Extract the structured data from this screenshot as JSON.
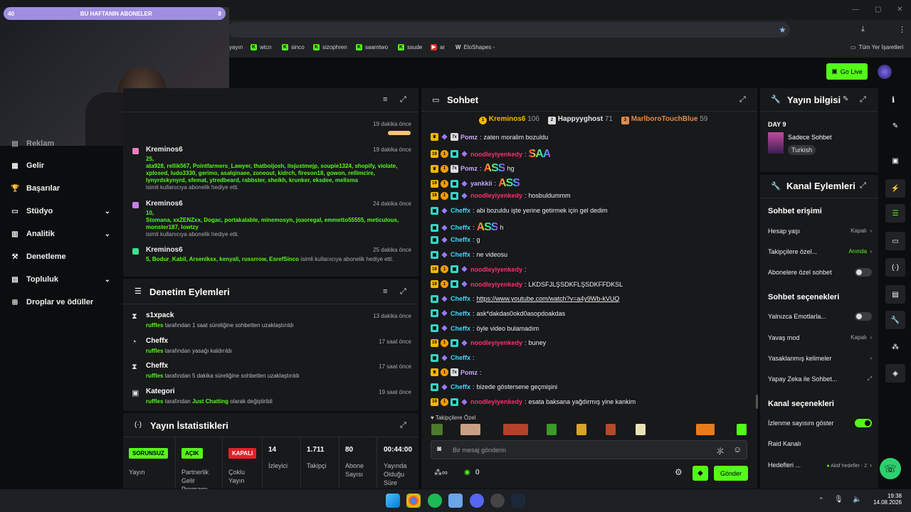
{
  "browser": {
    "bookmarks": [
      "yayın",
      "wtcn",
      "sinco",
      "sizophren",
      "saamtwo",
      "ssude",
      "ar",
      "EloShapes -"
    ],
    "all_bookmarks": "Tüm Yer İşaretleri"
  },
  "topbar": {
    "go_live": "Go Live"
  },
  "webcam": {
    "sub_left": "40",
    "sub_title": "BU HAFTANIN ABONELER",
    "sub_right": "8"
  },
  "sidenav": {
    "items": [
      {
        "label": "Reklam",
        "icon": "ad-icon"
      },
      {
        "label": "Gelir",
        "icon": "revenue-icon"
      },
      {
        "label": "Başarılar",
        "icon": "trophy-icon"
      },
      {
        "label": "Stüdyo",
        "icon": "studio-icon"
      },
      {
        "label": "Analitik",
        "icon": "analytics-icon"
      },
      {
        "label": "Denetleme",
        "icon": "moderation-icon"
      },
      {
        "label": "Topluluk",
        "icon": "community-icon"
      },
      {
        "label": "Droplar ve ödüller",
        "icon": "drops-icon"
      }
    ]
  },
  "activity": {
    "items": [
      {
        "time": "19 dakika önce"
      },
      {
        "name": "Kreminos6",
        "time": "19 dakika önce",
        "count": "25,",
        "users": "ata928, rellik567, Pointfarmers_Lawyer, thatboijosh, itsjustmejp, soupie1324, shopify, violate, xplosed, ludo3330, gerimo, asalqinaee, zoneout, kidrch, fireson18, gowon, rellimcire, lynyrdskynyrd, sfemat, ytredbeard, rabbster, sheikh, krunker, eksdee, melisma",
        "suffix": "isimli kullanıcıya abonelik hediye etti."
      },
      {
        "name": "Kreminos6",
        "time": "24 dakika önce",
        "count": "10,",
        "users": "Stomana, xxZENZxx, Dogac, portakalable, minemosyn, joaoregal, emmetto55555, meticulous, monster187, lowtzy",
        "suffix": "isimli kullanıcıya abonelik hediye etti."
      },
      {
        "name": "Kreminos6",
        "time": "25 dakika önce",
        "count": "5,",
        "users": "Bodur_Kabil, Arseniksx, kenyali, russrrow, EsrefSinco",
        "suffix": "isimli kullanıcıya abonelik hediye etti."
      }
    ]
  },
  "moderation": {
    "title": "Denetim Eylemleri",
    "items": [
      {
        "name": "s1xpack",
        "by": "ruffles",
        "desc": "tarafından 1 saat süreliğine sohbetten uzaklaştırıldı",
        "time": "13 dakika önce",
        "icon": "hourglass-icon"
      },
      {
        "name": "Cheffx",
        "by": "ruffles",
        "desc": "tarafından yasağı kaldırıldı",
        "time": "17 saat önce",
        "icon": "clock-icon"
      },
      {
        "name": "Cheffx",
        "by": "ruffles",
        "desc": "tarafından 5 dakika süreliğine sohbetten uzaklaştırıldı",
        "time": "17 saat önce",
        "icon": "hourglass-icon"
      },
      {
        "name": "Kategori",
        "by": "ruffles",
        "desc_a": "tarafından",
        "cat": "Just Chatting",
        "desc": "olarak değiştirildi",
        "time": "19 saat önce",
        "icon": "category-icon"
      }
    ]
  },
  "stats": {
    "title": "Yayın İstatistikleri",
    "cols": [
      {
        "badge": "SORUNSUZ",
        "label": "Yayın",
        "color": "#53fc18"
      },
      {
        "badge": "AÇIK",
        "label": "Partnerlik Gelir Programı",
        "color": "#53fc18"
      },
      {
        "badge": "KAPALI",
        "label": "Çoklu Yayın",
        "color": "#e5202b"
      },
      {
        "value": "14",
        "label": "İzleyici"
      },
      {
        "value": "1.711",
        "label": "Takipçi"
      },
      {
        "value": "80",
        "label": "Abone Sayısı"
      },
      {
        "value": "00:44:00",
        "label": "Yayında Olduğu Süre"
      }
    ]
  },
  "chat": {
    "title": "Sohbet",
    "top": [
      {
        "name": "Kreminos6",
        "val": "106"
      },
      {
        "name": "Happyyghost",
        "val": "71"
      },
      {
        "name": "MarlboroTouchBlue",
        "val": "59"
      }
    ],
    "messages": [
      {
        "badges": [
          "crown",
          "gem",
          "vip"
        ],
        "user": "Pomz",
        "color": "#c9a8ff",
        "text": "zaten moralim bozuldu"
      },
      {
        "badges": [
          "sub19",
          "coin",
          "tile",
          "gem"
        ],
        "user": "noodleyiyenkedy",
        "color": "#ff2d6f",
        "emote": "SAA"
      },
      {
        "badges": [
          "crown",
          "coin",
          "vip"
        ],
        "user": "Pomz",
        "color": "#c9a8ff",
        "emote": "ASS",
        "text": "hg"
      },
      {
        "badges": [
          "sub19",
          "coin",
          "tile",
          "gem"
        ],
        "user": "yankkii",
        "color": "#c9a8ff",
        "emote": "ASS"
      },
      {
        "badges": [
          "sub19",
          "coin",
          "tile",
          "gem"
        ],
        "user": "noodleyiyenkedy",
        "color": "#ff2d6f",
        "text": "hosbuldummm"
      },
      {
        "badges": [
          "tile",
          "gem"
        ],
        "user": "Cheffx",
        "color": "#3fd8ff",
        "text": "abi bozuldu işte yerine getirmek için gel dedim"
      },
      {
        "badges": [
          "tile",
          "gem"
        ],
        "user": "Cheffx",
        "color": "#3fd8ff",
        "emote": "ASS",
        "text": "h"
      },
      {
        "badges": [
          "tile",
          "gem"
        ],
        "user": "Cheffx",
        "color": "#3fd8ff",
        "text": "g"
      },
      {
        "badges": [
          "tile",
          "gem"
        ],
        "user": "Cheffx",
        "color": "#3fd8ff",
        "text": "ne videosu"
      },
      {
        "badges": [
          "sub19",
          "coin",
          "tile",
          "gem"
        ],
        "user": "noodleyiyenkedy",
        "color": "#ff2d6f",
        "text": ""
      },
      {
        "badges": [
          "sub19",
          "coin",
          "tile",
          "gem"
        ],
        "user": "noodleyiyenkedy",
        "color": "#ff2d6f",
        "text": "LKDSFJLŞSDKFLŞSDKFFDKSL"
      },
      {
        "badges": [
          "tile",
          "gem"
        ],
        "user": "Cheffx",
        "color": "#3fd8ff",
        "link": "https://www.youtube.com/watch?v=a4y9Wb-kVUQ"
      },
      {
        "badges": [
          "tile",
          "gem"
        ],
        "user": "Cheffx",
        "color": "#3fd8ff",
        "text": "ask*dakdas0okd0asopdoakdas"
      },
      {
        "badges": [
          "tile",
          "gem"
        ],
        "user": "Cheffx",
        "color": "#3fd8ff",
        "text": "öyle video bulamadım"
      },
      {
        "badges": [
          "sub19",
          "coin",
          "tile",
          "gem"
        ],
        "user": "noodleyiyenkedy",
        "color": "#ff2d6f",
        "text": "buney"
      },
      {
        "badges": [
          "tile",
          "gem"
        ],
        "user": "Cheffx",
        "color": "#3fd8ff",
        "text": ""
      },
      {
        "badges": [
          "crown",
          "coin",
          "vip"
        ],
        "user": "Pomz",
        "color": "#c9a8ff",
        "text": ""
      },
      {
        "badges": [
          "tile",
          "gem"
        ],
        "user": "Cheffx",
        "color": "#3fd8ff",
        "text": "bizede göstersene geçmişini"
      },
      {
        "badges": [
          "sub19",
          "coin",
          "tile",
          "gem"
        ],
        "user": "noodleyiyenkedy",
        "color": "#ff2d6f",
        "text": "esata baksana yağdırmış yine kankim"
      }
    ],
    "emote_label": "Takipçilere Özel",
    "placeholder": "Bir mesaj gönderin",
    "coins": "0",
    "send": "Gönder",
    "sub_badge_num": "19"
  },
  "info": {
    "title": "Yayın bilgisi",
    "day": "DAY 9",
    "stream_title": "Sadece Sohbet",
    "language": "Turkish"
  },
  "channel": {
    "title": "Kanal Eylemleri",
    "s1": "Sohbet erişimi",
    "rows1": [
      {
        "label": "Hesap yaşı",
        "value": "Kapalı"
      },
      {
        "label": "Takipçilere özel...",
        "value": "Anında"
      },
      {
        "label": "Abonelere özel sohbet"
      }
    ],
    "s2": "Sohbet seçenekleri",
    "rows2": [
      {
        "label": "Yalnızca Emotlarla..."
      },
      {
        "label": "Yavaş mod",
        "value": "Kapalı"
      },
      {
        "label": "Yasaklanmış kelimeler"
      },
      {
        "label": "Yapay Zeka ile Sohbet..."
      }
    ],
    "s3": "Kanal seçenekleri",
    "rows3": [
      {
        "label": "İzlenme sayısını göster"
      },
      {
        "label": "Raid Kanalı"
      },
      {
        "label": "Hedefleri ...",
        "value": "Aktif hedefler - 2"
      }
    ]
  },
  "taskbar": {
    "time": "19:38",
    "date": "14.08.2026"
  }
}
